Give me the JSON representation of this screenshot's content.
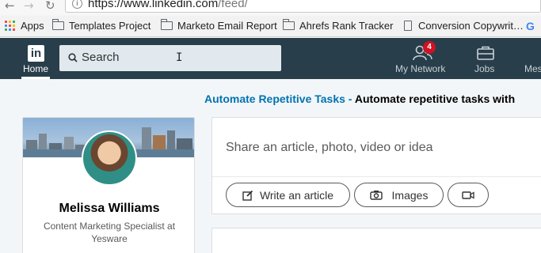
{
  "browser": {
    "url_host": "https://www.linkedin.com",
    "url_path": "/feed/"
  },
  "bookmarks": [
    {
      "label": "Apps",
      "icon": "apps-grid-icon"
    },
    {
      "label": "Templates Project",
      "icon": "folder-icon"
    },
    {
      "label": "Marketo Email Report",
      "icon": "folder-icon"
    },
    {
      "label": "Ahrefs Rank Tracker",
      "icon": "folder-icon"
    },
    {
      "label": "Conversion Copywrit…",
      "icon": "page-icon"
    },
    {
      "label": "G",
      "icon": "google-icon"
    }
  ],
  "nav": {
    "logo": "in",
    "home_label": "Home",
    "search_placeholder": "Search",
    "network_label": "My Network",
    "network_badge": "4",
    "jobs_label": "Jobs",
    "messaging_label": "Mes"
  },
  "ad": {
    "brand": "Automate Repetitive Tasks -",
    "text": "Automate repetitive tasks with"
  },
  "profile": {
    "name": "Melissa Williams",
    "headline": "Content Marketing Specialist at Yesware"
  },
  "share": {
    "prompt": "Share an article, photo, video or idea",
    "write_article": "Write an article",
    "images": "Images"
  },
  "colors": {
    "nav_bg": "#283e4a",
    "brand_blue": "#0073b1",
    "badge_red": "#d11124",
    "page_bg": "#f3f6f8"
  }
}
